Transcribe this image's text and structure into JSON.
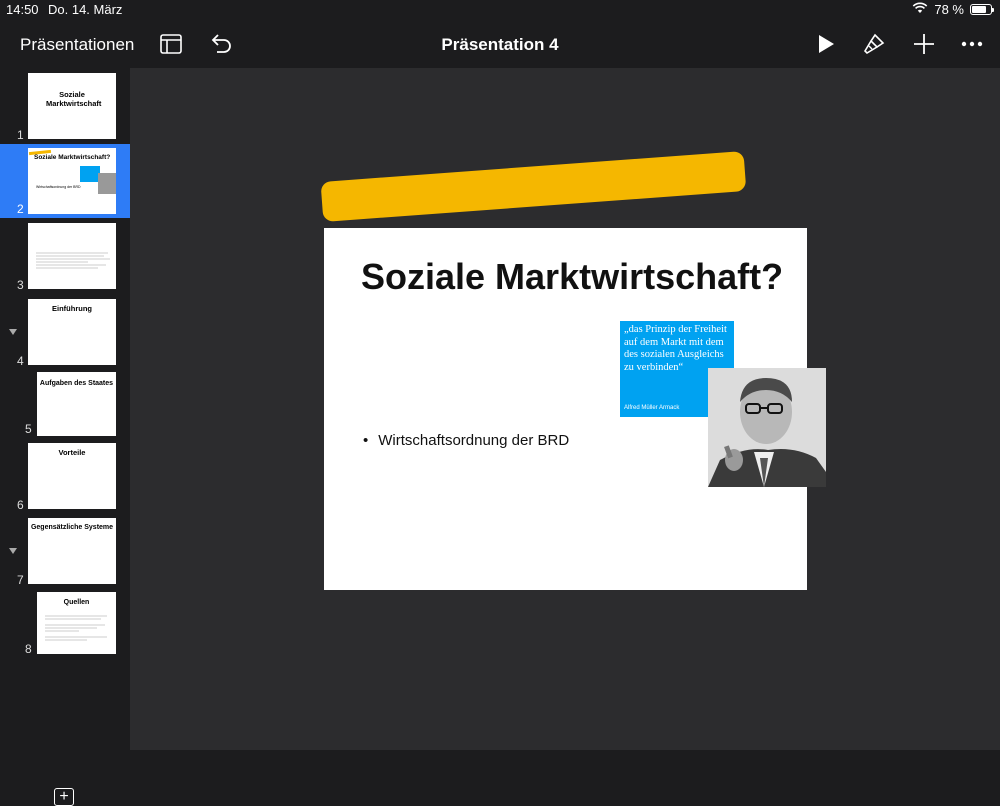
{
  "status_bar": {
    "time": "14:50",
    "date": "Do. 14. März",
    "battery_percent": "78 %",
    "battery_level": 0.78
  },
  "toolbar": {
    "back_label": "Präsentationen",
    "title": "Präsentation 4",
    "icons": [
      "sidebar-layout-icon",
      "undo-icon",
      "play-icon",
      "paintbrush-icon",
      "plus-icon",
      "more-icon"
    ]
  },
  "sidebar": {
    "slides": [
      {
        "number": "1",
        "title": "Soziale Marktwirtschaft"
      },
      {
        "number": "2",
        "title": "Soziale Marktwirtschaft?",
        "selected": true,
        "bullet": "Wirtschaftsordnung der BRD"
      },
      {
        "number": "3",
        "title": ""
      },
      {
        "number": "4",
        "title": "Einführung",
        "collapsible": true
      },
      {
        "number": "5",
        "title": "Aufgaben des Staates"
      },
      {
        "number": "6",
        "title": "Vorteile"
      },
      {
        "number": "7",
        "title": "Gegensätzliche Systeme",
        "collapsible": true
      },
      {
        "number": "8",
        "title": "Quellen"
      }
    ]
  },
  "slide": {
    "title": "Soziale Marktwirtschaft?",
    "bullet": "Wirtschaftsordnung der BRD",
    "quote": "„das Prinzip der Freiheit auf dem Markt mit dem des sozialen Ausgleichs zu verbinden“",
    "quote_author": "Alfred Müller Armack"
  },
  "colors": {
    "accent_blue": "#2e7cf6",
    "highlight_yellow": "#f5b700",
    "quote_blue": "#00a2f1"
  }
}
